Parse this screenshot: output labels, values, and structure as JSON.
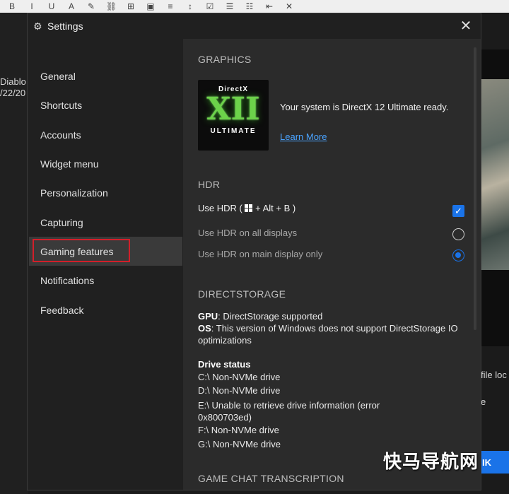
{
  "background": {
    "toolbar_glyphs": [
      "B",
      "I",
      "U",
      "A",
      "✎",
      "⛓",
      "⊞",
      "▣",
      "≡",
      "↕",
      "☑",
      "☰",
      "☷",
      "⇤",
      "✕"
    ],
    "left_text_1": "Diablo",
    "left_text_2": "/22/20",
    "right_text_1": "file loc",
    "right_text_2": "e",
    "ok_button": "IK",
    "watermark": "快马导航网"
  },
  "dialog": {
    "title": "Settings",
    "icons": {
      "settings": "gear-icon",
      "close": "close-icon"
    },
    "sidebar": {
      "items": [
        {
          "label": "General"
        },
        {
          "label": "Shortcuts"
        },
        {
          "label": "Accounts"
        },
        {
          "label": "Widget menu"
        },
        {
          "label": "Personalization"
        },
        {
          "label": "Capturing"
        },
        {
          "label": "Gaming features",
          "selected": true
        },
        {
          "label": "Notifications"
        },
        {
          "label": "Feedback"
        }
      ]
    },
    "content": {
      "graphics": {
        "heading": "GRAPHICS",
        "logo_top": "DirectX",
        "logo_main": "XII",
        "logo_bottom": "ULTIMATE",
        "status": "Your system is DirectX 12 Ultimate ready.",
        "learn_more": "Learn More"
      },
      "hdr": {
        "heading": "HDR",
        "use_hdr_prefix": "Use HDR (",
        "use_hdr_suffix": "+ Alt + B )",
        "use_hdr_checked": true,
        "all_displays": "Use HDR on all displays",
        "main_display": "Use HDR on main display only",
        "selected": "main_display"
      },
      "directstorage": {
        "heading": "DIRECTSTORAGE",
        "gpu_label": "GPU",
        "gpu_text": ": DirectStorage supported",
        "os_label": "OS",
        "os_text": ": This version of Windows does not support DirectStorage IO optimizations",
        "drive_status": "Drive status",
        "drives": [
          "C:\\ Non-NVMe drive",
          "D:\\ Non-NVMe drive",
          "E:\\ Unable to retrieve drive information (error 0x800703ed)",
          "F:\\ Non-NVMe drive",
          "G:\\ Non-NVMe drive"
        ]
      },
      "game_chat": {
        "heading": "GAME CHAT TRANSCRIPTION"
      }
    }
  },
  "colors": {
    "accent": "#1a73e8",
    "highlight_box": "#d21f2a",
    "directx_green": "#6cd24a",
    "link": "#4aa3ff"
  }
}
